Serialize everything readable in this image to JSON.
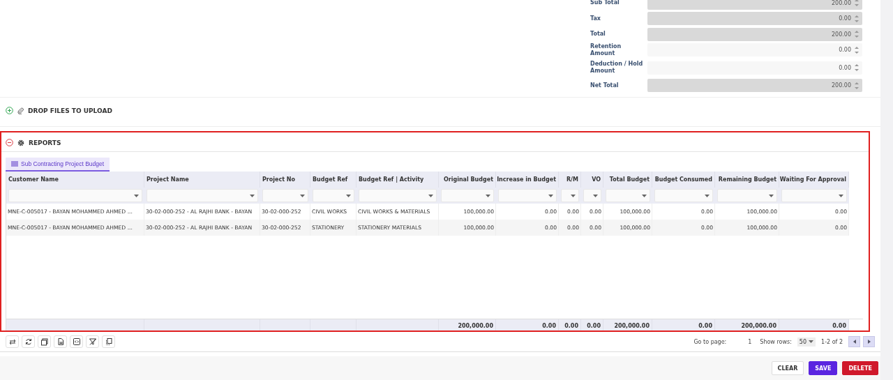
{
  "totals_form": {
    "fields": [
      {
        "label": "Sub Total",
        "value": "200.00",
        "readonly": true
      },
      {
        "label": "Tax",
        "value": "0.00",
        "readonly": true
      },
      {
        "label": "Total",
        "value": "200.00",
        "readonly": true
      },
      {
        "label": "Retention Amount",
        "value": "0.00",
        "readonly": false
      },
      {
        "label": "Deduction / Hold Amount",
        "value": "0.00",
        "readonly": false
      },
      {
        "label": "Net Total",
        "value": "200.00",
        "readonly": true
      }
    ]
  },
  "sections": [
    {
      "title": "DROP FILES TO UPLOAD",
      "expanded": false,
      "kind": "upload"
    },
    {
      "title": "REPORTS",
      "expanded": true,
      "kind": "reports"
    }
  ],
  "reports": {
    "tabs": [
      {
        "label": "Sub Contracting Project Budget",
        "selected": true
      }
    ],
    "table": {
      "columns": [
        {
          "label": "Customer Name",
          "kind": "text"
        },
        {
          "label": "Project Name",
          "kind": "text"
        },
        {
          "label": "Project No",
          "kind": "text"
        },
        {
          "label": "Budget Ref",
          "kind": "text"
        },
        {
          "label": "Budget Ref | Activity",
          "kind": "text"
        },
        {
          "label": "Original Budget",
          "kind": "amount"
        },
        {
          "label": "Increase in Budget",
          "kind": "amount"
        },
        {
          "label": "R/M",
          "kind": "amount"
        },
        {
          "label": "VO",
          "kind": "amount"
        },
        {
          "label": "Total Budget",
          "kind": "amount"
        },
        {
          "label": "Budget Consumed",
          "kind": "amount"
        },
        {
          "label": "Remaining Budget",
          "kind": "amount"
        },
        {
          "label": "Waiting For Approval",
          "kind": "amount"
        }
      ],
      "rows": [
        [
          "MNE-C-005017 - BAYAN MOHAMMED AHMED ...",
          "30-02-000-252 - AL RAJHI BANK - BAYAN",
          "30-02-000-252",
          "CIVIL WORKS",
          "CIVIL WORKS & MATERIALS",
          "100,000.00",
          "0.00",
          "0.00",
          "0.00",
          "100,000.00",
          "0.00",
          "100,000.00",
          "0.00"
        ],
        [
          "MNE-C-005017 - BAYAN MOHAMMED AHMED ...",
          "30-02-000-252 - AL RAJHI BANK - BAYAN",
          "30-02-000-252",
          "STATIONERY",
          "STATIONERY MATERIALS",
          "100,000.00",
          "0.00",
          "0.00",
          "0.00",
          "100,000.00",
          "0.00",
          "100,000.00",
          "0.00"
        ]
      ],
      "footer": [
        "200,000.00",
        "0.00",
        "0.00",
        "0.00",
        "200,000.00",
        "0.00",
        "200,000.00",
        "0.00"
      ]
    },
    "pager": {
      "go_to_label": "Go to page:",
      "page": "1",
      "show_rows_label": "Show rows:",
      "rows_per_page": "50",
      "range": "1-2 of 2"
    }
  },
  "actions": [
    {
      "label": "CLEAR",
      "kind": "neutral"
    },
    {
      "label": "SAVE",
      "kind": "primary"
    },
    {
      "label": "DELETE",
      "kind": "danger"
    }
  ]
}
